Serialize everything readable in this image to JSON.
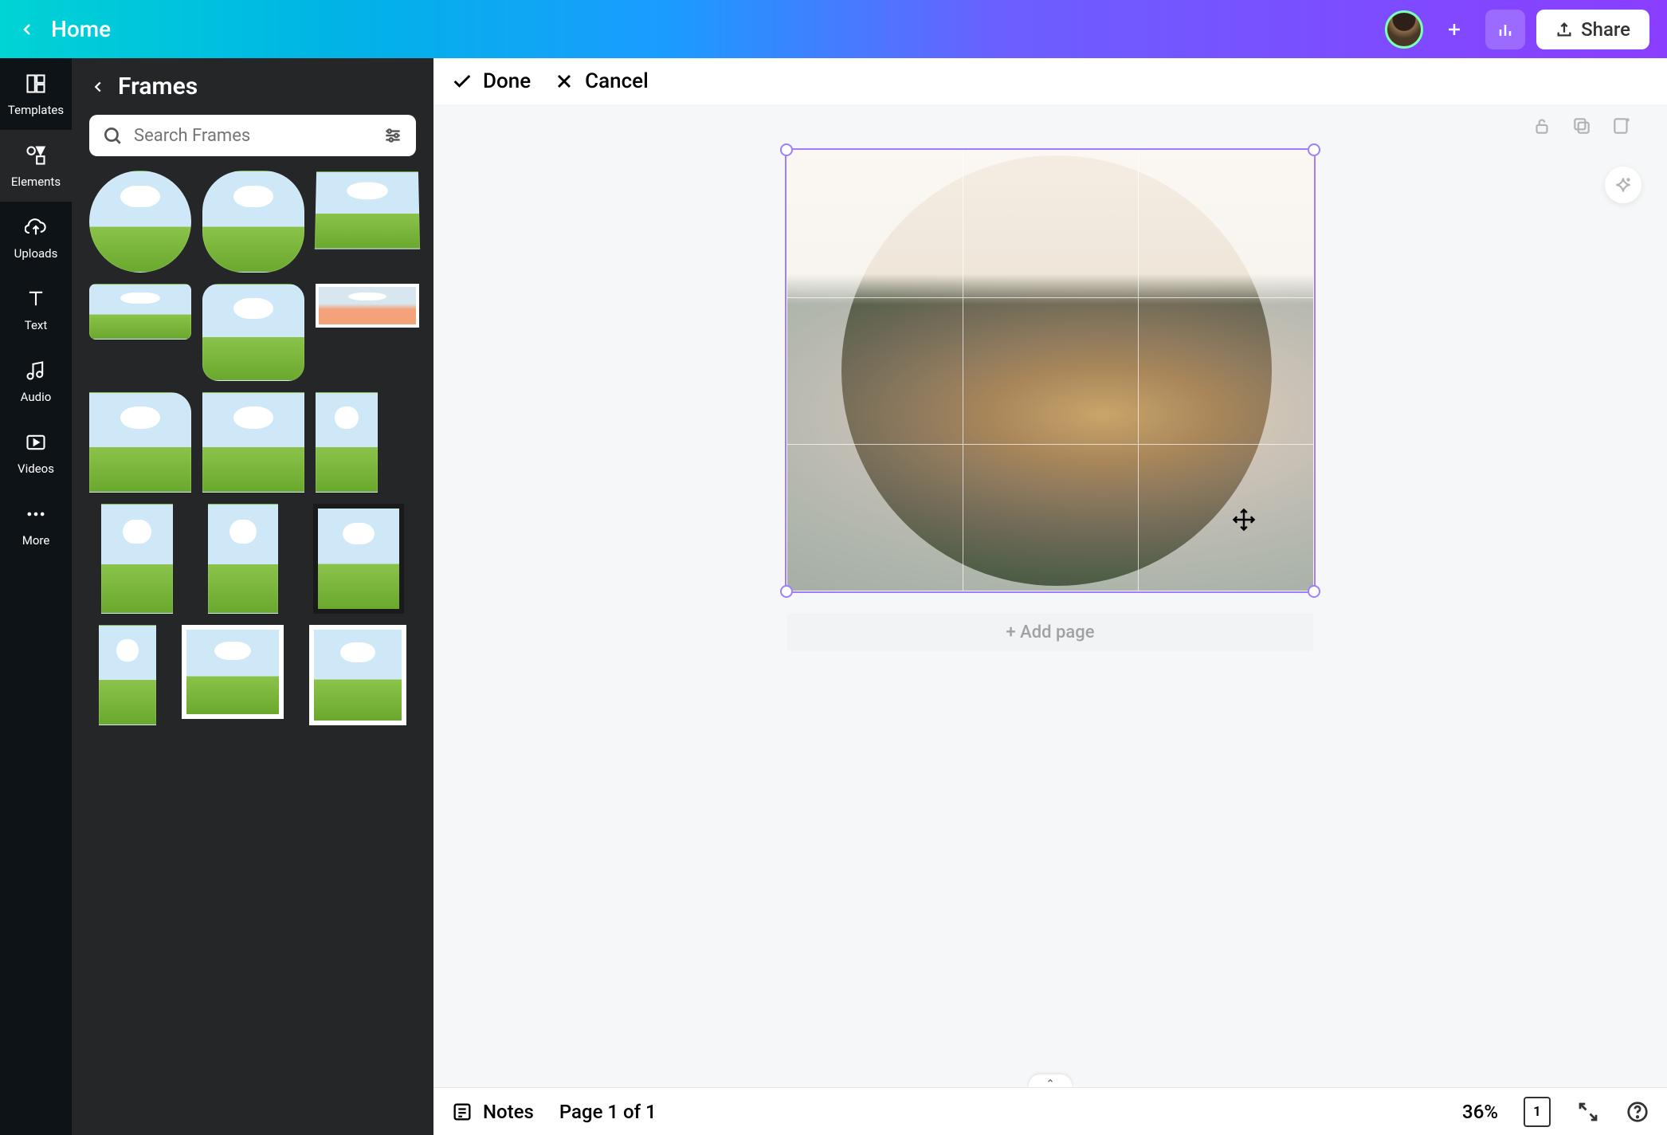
{
  "header": {
    "home_label": "Home",
    "share_label": "Share"
  },
  "left_rail": {
    "items": [
      {
        "label": "Templates"
      },
      {
        "label": "Elements"
      },
      {
        "label": "Uploads"
      },
      {
        "label": "Text"
      },
      {
        "label": "Audio"
      },
      {
        "label": "Videos"
      },
      {
        "label": "More"
      }
    ],
    "active_index": 1
  },
  "side_panel": {
    "title": "Frames",
    "search_placeholder": "Search Frames"
  },
  "edit_bar": {
    "done_label": "Done",
    "cancel_label": "Cancel"
  },
  "canvas": {
    "add_page_label": "+ Add page"
  },
  "bottom_bar": {
    "notes_label": "Notes",
    "page_indicator": "Page 1 of 1",
    "zoom_label": "36%",
    "thumb_count": "1"
  }
}
